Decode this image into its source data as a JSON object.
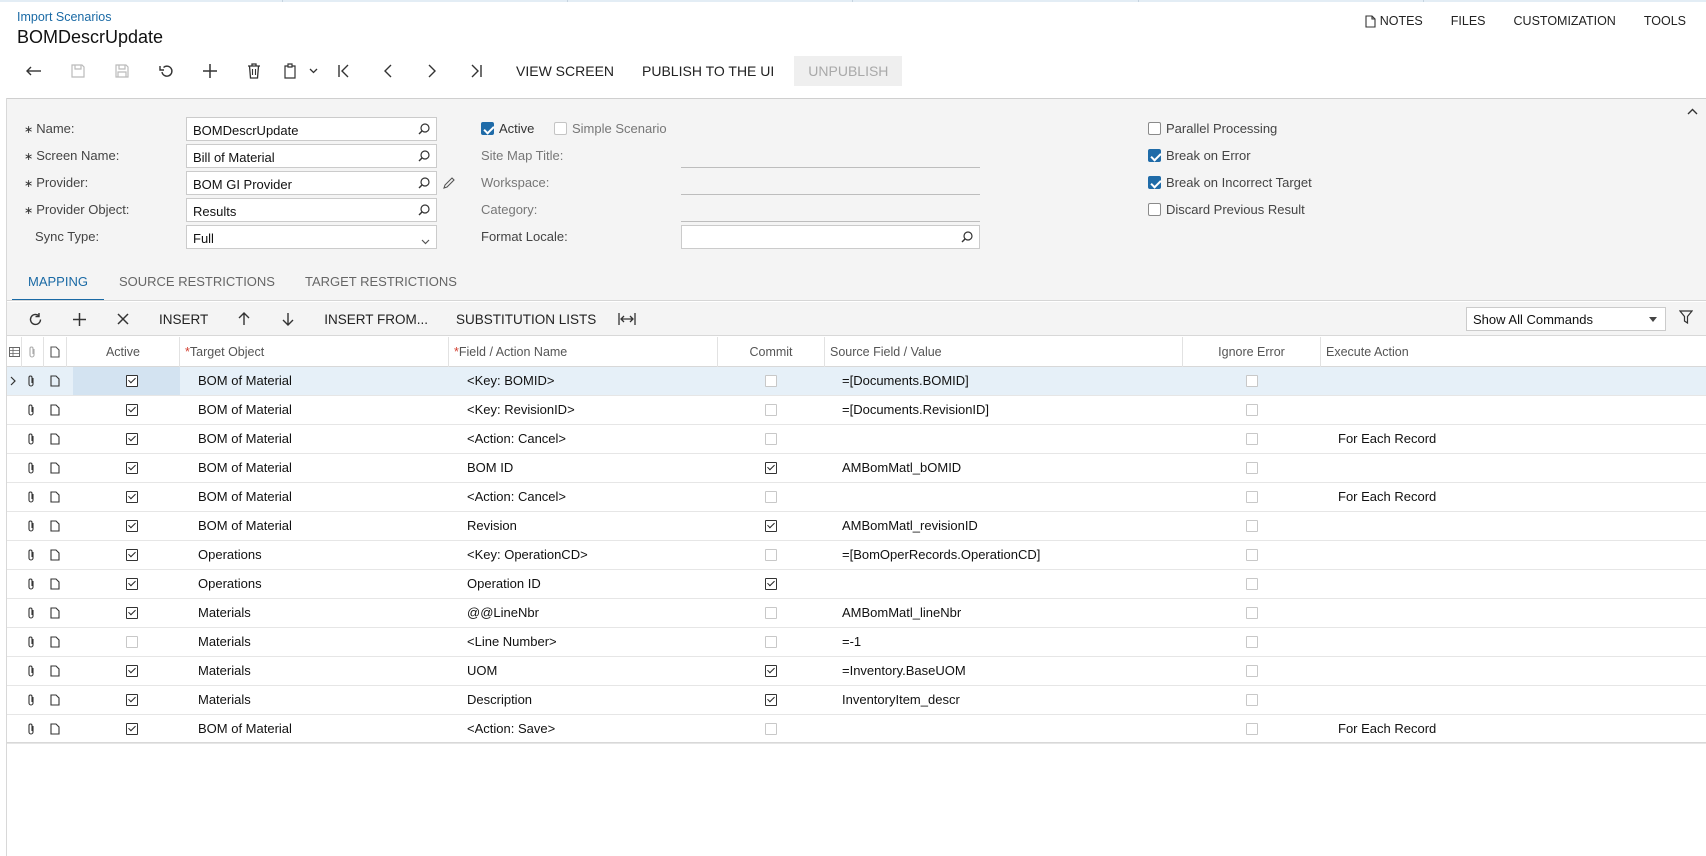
{
  "header": {
    "breadcrumb": "Import Scenarios",
    "title": "BOMDescrUpdate",
    "links": {
      "notes": "NOTES",
      "files": "FILES",
      "customization": "CUSTOMIZATION",
      "tools": "TOOLS"
    }
  },
  "toolbar": {
    "view_screen": "VIEW SCREEN",
    "publish": "PUBLISH TO THE UI",
    "unpublish": "UNPUBLISH"
  },
  "form": {
    "name": {
      "label": "Name:",
      "value": "BOMDescrUpdate"
    },
    "screen_name": {
      "label": "Screen Name:",
      "value": "Bill of Material"
    },
    "provider": {
      "label": "Provider:",
      "value": "BOM GI Provider"
    },
    "provider_object": {
      "label": "Provider Object:",
      "value": "Results"
    },
    "sync_type": {
      "label": "Sync Type:",
      "value": "Full"
    },
    "active": {
      "label": "Active",
      "checked": true
    },
    "simple_scenario": {
      "label": "Simple Scenario",
      "checked": false
    },
    "site_map_title": {
      "label": "Site Map Title:",
      "value": ""
    },
    "workspace": {
      "label": "Workspace:",
      "value": ""
    },
    "category": {
      "label": "Category:",
      "value": ""
    },
    "format_locale": {
      "label": "Format Locale:",
      "value": ""
    },
    "parallel_processing": {
      "label": "Parallel Processing",
      "checked": false
    },
    "break_on_error": {
      "label": "Break on Error",
      "checked": true
    },
    "break_on_incorrect_target": {
      "label": "Break on Incorrect Target",
      "checked": true
    },
    "discard_previous_result": {
      "label": "Discard Previous Result",
      "checked": false
    }
  },
  "tabs": [
    {
      "label": "MAPPING",
      "active": true
    },
    {
      "label": "SOURCE RESTRICTIONS",
      "active": false
    },
    {
      "label": "TARGET RESTRICTIONS",
      "active": false
    }
  ],
  "grid_toolbar": {
    "insert": "INSERT",
    "insert_from": "INSERT FROM...",
    "substitution_lists": "SUBSTITUTION LISTS",
    "show_commands": "Show All Commands"
  },
  "grid": {
    "columns": {
      "active": "Active",
      "target_object": "Target Object",
      "field_action": "Field / Action Name",
      "commit": "Commit",
      "source_field": "Source Field / Value",
      "ignore_error": "Ignore Error",
      "execute_action": "Execute Action"
    },
    "rows": [
      {
        "active": true,
        "target": "BOM of Material",
        "field": "<Key: BOMID>",
        "commit": false,
        "source": "=[Documents.BOMID]",
        "ignore": false,
        "execute": ""
      },
      {
        "active": true,
        "target": "BOM of Material",
        "field": "<Key: RevisionID>",
        "commit": false,
        "source": "=[Documents.RevisionID]",
        "ignore": false,
        "execute": ""
      },
      {
        "active": true,
        "target": "BOM of Material",
        "field": "<Action: Cancel>",
        "commit": false,
        "source": "",
        "ignore": false,
        "execute": "For Each Record"
      },
      {
        "active": true,
        "target": "BOM of Material",
        "field": "BOM ID",
        "commit": true,
        "source": "AMBomMatl_bOMID",
        "ignore": false,
        "execute": ""
      },
      {
        "active": true,
        "target": "BOM of Material",
        "field": "<Action: Cancel>",
        "commit": false,
        "source": "",
        "ignore": false,
        "execute": "For Each Record"
      },
      {
        "active": true,
        "target": "BOM of Material",
        "field": "Revision",
        "commit": true,
        "source": "AMBomMatl_revisionID",
        "ignore": false,
        "execute": ""
      },
      {
        "active": true,
        "target": "Operations",
        "field": "<Key: OperationCD>",
        "commit": false,
        "source": "=[BomOperRecords.OperationCD]",
        "ignore": false,
        "execute": ""
      },
      {
        "active": true,
        "target": "Operations",
        "field": "Operation ID",
        "commit": true,
        "source": "",
        "ignore": false,
        "execute": ""
      },
      {
        "active": true,
        "target": "Materials",
        "field": "@@LineNbr",
        "commit": false,
        "source": "AMBomMatl_lineNbr",
        "ignore": false,
        "execute": ""
      },
      {
        "active": false,
        "target": "Materials",
        "field": "<Line Number>",
        "commit": false,
        "source": "=-1",
        "ignore": false,
        "execute": ""
      },
      {
        "active": true,
        "target": "Materials",
        "field": "UOM",
        "commit": true,
        "source": "=Inventory.BaseUOM",
        "ignore": false,
        "execute": ""
      },
      {
        "active": true,
        "target": "Materials",
        "field": "Description",
        "commit": true,
        "source": "InventoryItem_descr",
        "ignore": false,
        "execute": ""
      },
      {
        "active": true,
        "target": "BOM of Material",
        "field": "<Action: Save>",
        "commit": false,
        "source": "",
        "ignore": false,
        "execute": "For Each Record"
      }
    ]
  }
}
